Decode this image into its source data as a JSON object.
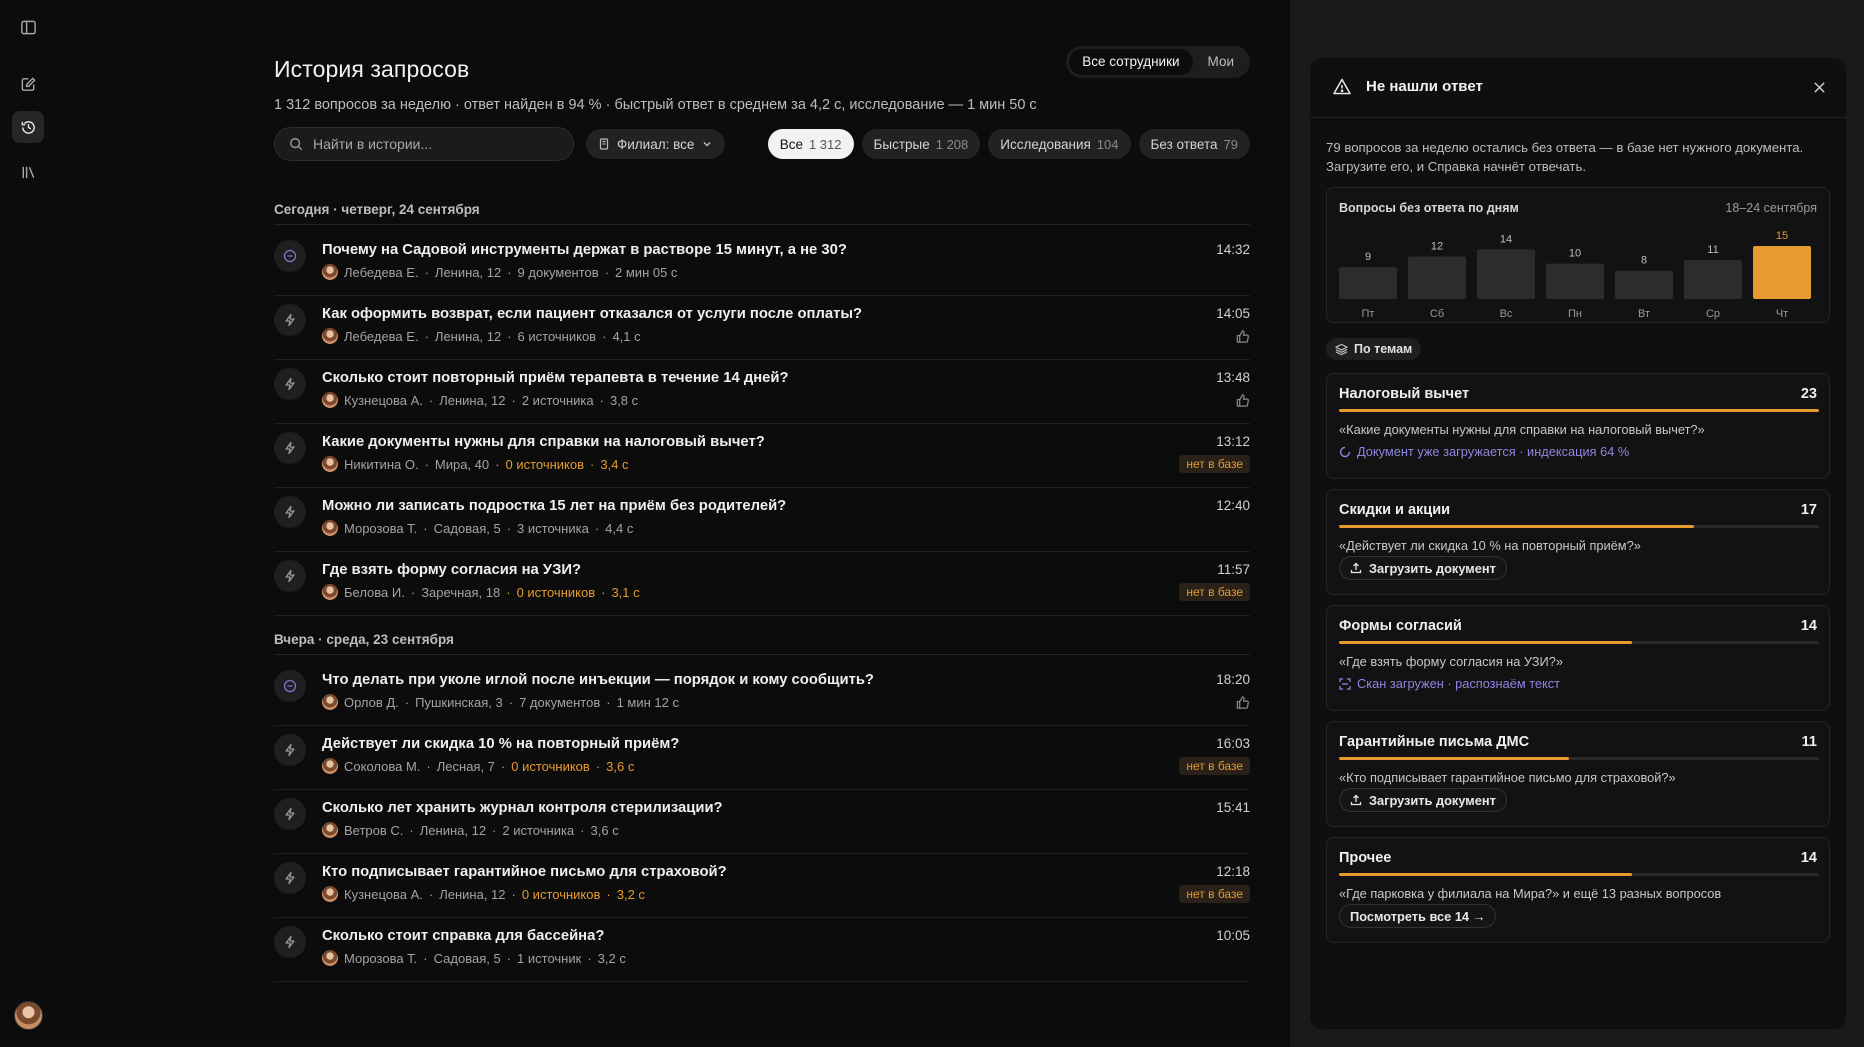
{
  "colors": {
    "accent": "#e69a2f",
    "research": "#7f74c9",
    "status": "#8f86e0",
    "bar": "#2c2c2c"
  },
  "main": {
    "title": "История запросов",
    "subtitle": "1 312 вопросов за неделю · ответ найден в 94 % · быстрый ответ в среднем за 4,2 с, исследование — 1 мин 50 с",
    "scope": [
      "Все сотрудники",
      "Мои"
    ],
    "search_placeholder": "Найти в истории...",
    "branch_filter": "Филиал: все",
    "chips": [
      {
        "label": "Все",
        "count": "1 312"
      },
      {
        "label": "Быстрые",
        "count": "1 208"
      },
      {
        "label": "Исследования",
        "count": "104"
      },
      {
        "label": "Без ответа",
        "count": "79"
      }
    ],
    "groups": [
      {
        "day": "Сегодня · четверг, 24 сентября",
        "rows": [
          {
            "icon": "research-icon",
            "question": "Почему на Садовой инструменты держат в растворе 15 минут, а не 30?",
            "meta": [
              "Лебедева Е.",
              "Ленина, 12",
              "9 документов",
              "2 мин 05 с"
            ],
            "warn": [],
            "time": "14:32",
            "extra": ""
          },
          {
            "icon": "bolt-icon",
            "question": "Как оформить возврат, если пациент отказался от услуги после оплаты?",
            "meta": [
              "Лебедева Е.",
              "Ленина, 12",
              "6 источников",
              "4,1 с"
            ],
            "warn": [],
            "time": "14:05",
            "extra": "thumb"
          },
          {
            "icon": "bolt-icon",
            "question": "Сколько стоит повторный приём терапевта в течение 14 дней?",
            "meta": [
              "Кузнецова А.",
              "Ленина, 12",
              "2 источника",
              "3,8 с"
            ],
            "warn": [],
            "time": "13:48",
            "extra": "thumb"
          },
          {
            "icon": "bolt-icon",
            "question": "Какие документы нужны для справки на налоговый вычет?",
            "meta": [
              "Никитина О.",
              "Мира, 40"
            ],
            "warn": [
              "0 источников",
              "3,4 с"
            ],
            "time": "13:12",
            "extra": "нет в базе"
          },
          {
            "icon": "bolt-icon",
            "question": "Можно ли записать подростка 15 лет на приём без родителей?",
            "meta": [
              "Морозова Т.",
              "Садовая, 5",
              "3 источника",
              "4,4 с"
            ],
            "warn": [],
            "time": "12:40",
            "extra": ""
          },
          {
            "icon": "bolt-icon",
            "question": "Где взять форму согласия на УЗИ?",
            "meta": [
              "Белова И.",
              "Заречная, 18"
            ],
            "warn": [
              "0 источников",
              "3,1 с"
            ],
            "time": "11:57",
            "extra": "нет в базе"
          }
        ]
      },
      {
        "day": "Вчера · среда, 23 сентября",
        "rows": [
          {
            "icon": "research-icon",
            "question": "Что делать при уколе иглой после инъекции — порядок и кому сообщить?",
            "meta": [
              "Орлов Д.",
              "Пушкинская, 3",
              "7 документов",
              "1 мин 12 с"
            ],
            "warn": [],
            "time": "18:20",
            "extra": "thumb"
          },
          {
            "icon": "bolt-icon",
            "question": "Действует ли скидка 10 % на повторный приём?",
            "meta": [
              "Соколова М.",
              "Лесная, 7"
            ],
            "warn": [
              "0 источников",
              "3,6 с"
            ],
            "time": "16:03",
            "extra": "нет в базе"
          },
          {
            "icon": "bolt-icon",
            "question": "Сколько лет хранить журнал контроля стерилизации?",
            "meta": [
              "Ветров С.",
              "Ленина, 12",
              "2 источника",
              "3,6 с"
            ],
            "warn": [],
            "time": "15:41",
            "extra": ""
          },
          {
            "icon": "bolt-icon",
            "question": "Кто подписывает гарантийное письмо для страховой?",
            "meta": [
              "Кузнецова А.",
              "Ленина, 12"
            ],
            "warn": [
              "0 источников",
              "3,2 с"
            ],
            "time": "12:18",
            "extra": "нет в базе"
          },
          {
            "icon": "bolt-icon",
            "question": "Сколько стоит справка для бассейна?",
            "meta": [
              "Морозова Т.",
              "Садовая, 5",
              "1 источник",
              "3,2 с"
            ],
            "warn": [],
            "time": "10:05",
            "extra": ""
          }
        ]
      }
    ]
  },
  "panel": {
    "title": "Не нашли ответ",
    "intro": "79 вопросов за неделю остались без ответа — в базе нет нужного документа. Загрузите его, и Справка начнёт отвечать.",
    "chart_title": "Вопросы без ответа по дням",
    "chart_range": "18–24 сентября",
    "topics_label": "По темам",
    "topics": [
      {
        "name": "Налоговый вычет",
        "count": 23,
        "share": 1.0,
        "quote": "«Какие документы нужны для справки на налоговый вычет?»",
        "action_type": "status",
        "action": "Документ уже загружается · индексация 64 %",
        "action_icon": "spinner-icon"
      },
      {
        "name": "Скидки и акции",
        "count": 17,
        "share": 0.74,
        "quote": "«Действует ли скидка 10 % на повторный приём?»",
        "action_type": "button",
        "action": "Загрузить документ",
        "action_icon": "upload-icon"
      },
      {
        "name": "Формы согласий",
        "count": 14,
        "share": 0.61,
        "quote": "«Где взять форму согласия на УЗИ?»",
        "action_type": "status",
        "action": "Скан загружен · распознаём текст",
        "action_icon": "scan-icon"
      },
      {
        "name": "Гарантийные письма ДМС",
        "count": 11,
        "share": 0.48,
        "quote": "«Кто подписывает гарантийное письмо для страховой?»",
        "action_type": "button",
        "action": "Загрузить документ",
        "action_icon": "upload-icon"
      },
      {
        "name": "Прочее",
        "count": 14,
        "share": 0.61,
        "quote": "«Где парковка у филиала на Мира?» и ещё 13 разных вопросов",
        "action_type": "button",
        "action": "Посмотреть все 14 →",
        "action_icon": ""
      }
    ]
  },
  "chart_data": {
    "type": "bar",
    "title": "Вопросы без ответа по дням",
    "categories": [
      "Пт",
      "Сб",
      "Вс",
      "Пн",
      "Вт",
      "Ср",
      "Чт"
    ],
    "values": [
      9,
      12,
      14,
      10,
      8,
      11,
      15
    ],
    "highlight_index": 6,
    "ylim": [
      0,
      15
    ]
  }
}
